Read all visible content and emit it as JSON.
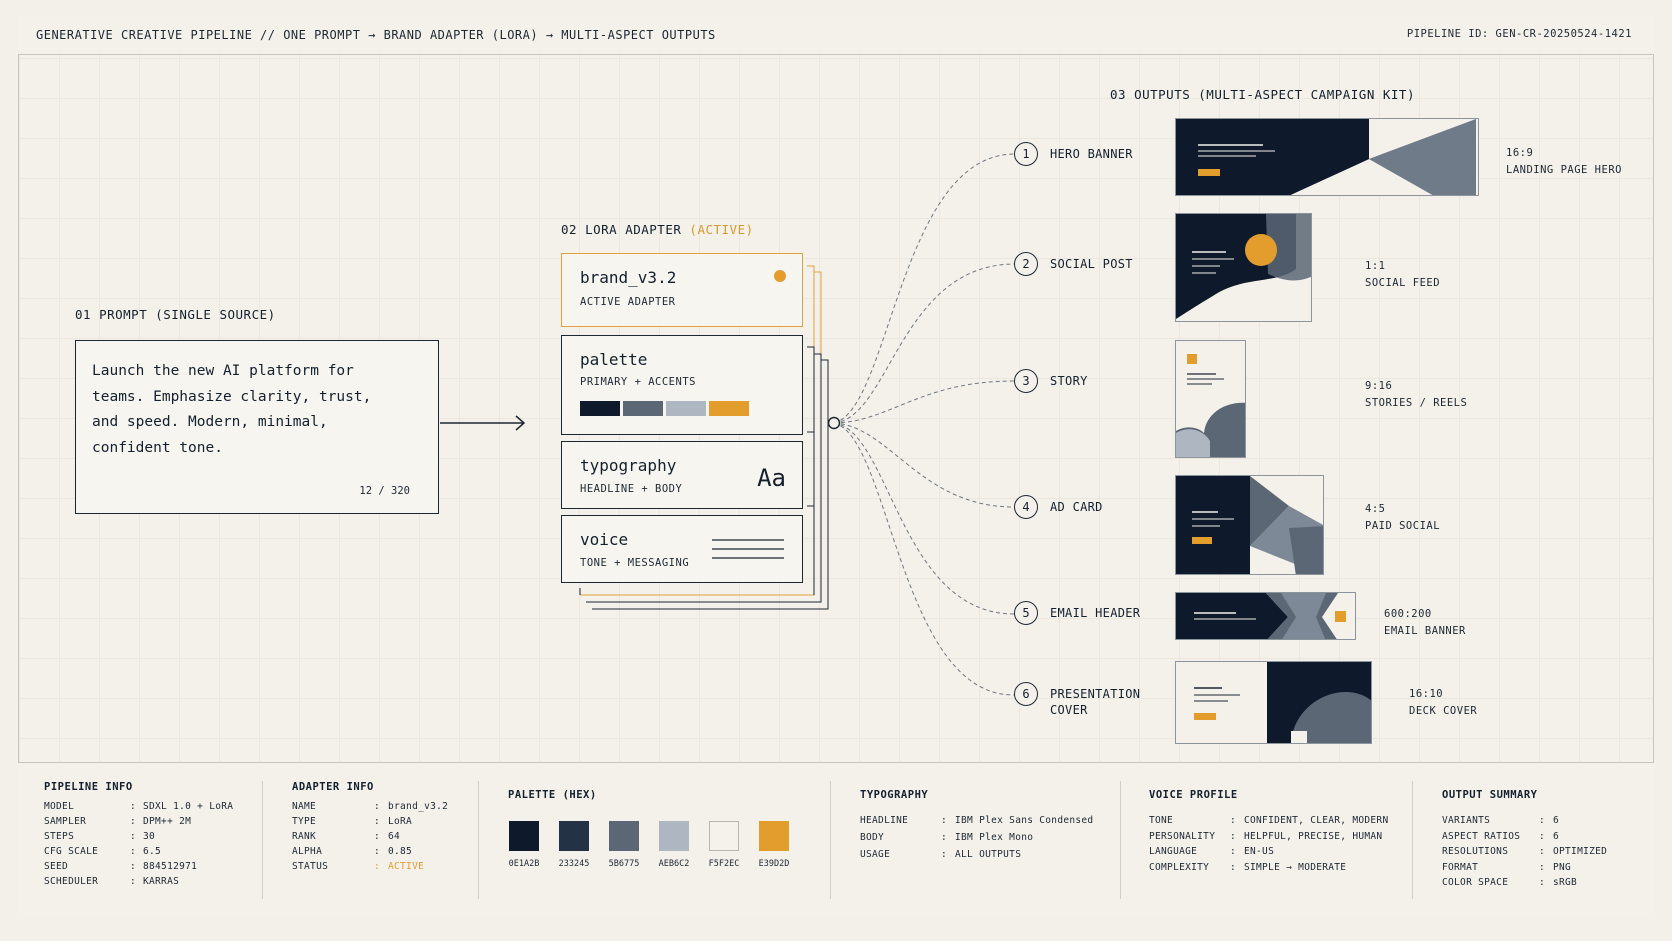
{
  "header": {
    "title": "GENERATIVE CREATIVE PIPELINE  // ONE PROMPT → BRAND ADAPTER (LORA) → MULTI-ASPECT OUTPUTS",
    "pipeline_id": "PIPELINE ID:  GEN-CR-20250524-1421"
  },
  "prompt": {
    "section_title": "01  PROMPT (SINGLE SOURCE)",
    "text": "Launch the new AI platform for teams. Emphasize clarity, trust, and speed. Modern, minimal, confident tone.",
    "count": "12 / 320"
  },
  "adapter": {
    "section_title": "02  LORA ADAPTER",
    "section_status": "(ACTIVE)",
    "cards": [
      {
        "title": "brand_v3.2",
        "sub": "ACTIVE ADAPTER"
      },
      {
        "title": "palette",
        "sub": "PRIMARY + ACCENTS"
      },
      {
        "title": "typography",
        "sub": "HEADLINE + BODY",
        "glyph": "Aa"
      },
      {
        "title": "voice",
        "sub": "TONE + MESSAGING"
      }
    ]
  },
  "outputs": {
    "section_title": "03  OUTPUTS (MULTI-ASPECT CAMPAIGN KIT)",
    "items": [
      {
        "n": "1",
        "label": "HERO BANNER",
        "ratio": "16:9",
        "use": "LANDING PAGE HERO"
      },
      {
        "n": "2",
        "label": "SOCIAL POST",
        "ratio": "1:1",
        "use": "SOCIAL FEED"
      },
      {
        "n": "3",
        "label": "STORY",
        "ratio": "9:16",
        "use": "STORIES / REELS"
      },
      {
        "n": "4",
        "label": "AD CARD",
        "ratio": "4:5",
        "use": "PAID SOCIAL"
      },
      {
        "n": "5",
        "label": "EMAIL HEADER",
        "ratio": "600:200",
        "use": "EMAIL BANNER"
      },
      {
        "n": "6",
        "label": "PRESENTATION",
        "label2": "COVER",
        "ratio": "16:10",
        "use": "DECK COVER"
      }
    ]
  },
  "colors": {
    "navy": "#0E1A2B",
    "slate": "#233245",
    "steel": "#5B6775",
    "mist": "#AEB6C2",
    "paper": "#F5F2EC",
    "accent": "#E39D2D"
  },
  "footer": {
    "pipeline": {
      "title": "PIPELINE INFO",
      "rows": [
        {
          "k": "MODEL",
          "v": "SDXL 1.0 + LoRA"
        },
        {
          "k": "SAMPLER",
          "v": "DPM++ 2M"
        },
        {
          "k": "STEPS",
          "v": "30"
        },
        {
          "k": "CFG SCALE",
          "v": "6.5"
        },
        {
          "k": "SEED",
          "v": "884512971"
        },
        {
          "k": "SCHEDULER",
          "v": "KARRAS"
        }
      ]
    },
    "adapter": {
      "title": "ADAPTER INFO",
      "rows": [
        {
          "k": "NAME",
          "v": "brand_v3.2"
        },
        {
          "k": "TYPE",
          "v": "LoRA"
        },
        {
          "k": "RANK",
          "v": "64"
        },
        {
          "k": "ALPHA",
          "v": "0.85"
        },
        {
          "k": "STATUS",
          "v": "ACTIVE"
        }
      ]
    },
    "palette": {
      "title": "PALETTE (HEX)",
      "swatches": [
        "0E1A2B",
        "233245",
        "5B6775",
        "AEB6C2",
        "F5F2EC",
        "E39D2D"
      ]
    },
    "typography": {
      "title": "TYPOGRAPHY",
      "rows": [
        {
          "k": "HEADLINE",
          "v": "IBM Plex Sans Condensed"
        },
        {
          "k": "BODY",
          "v": "IBM Plex Mono"
        },
        {
          "k": "USAGE",
          "v": "ALL OUTPUTS"
        }
      ]
    },
    "voice": {
      "title": "VOICE PROFILE",
      "rows": [
        {
          "k": "TONE",
          "v": "CONFIDENT, CLEAR, MODERN"
        },
        {
          "k": "PERSONALITY",
          "v": "HELPFUL, PRECISE, HUMAN"
        },
        {
          "k": "LANGUAGE",
          "v": "EN-US"
        },
        {
          "k": "COMPLEXITY",
          "v": "SIMPLE → MODERATE"
        }
      ]
    },
    "summary": {
      "title": "OUTPUT SUMMARY",
      "rows": [
        {
          "k": "VARIANTS",
          "v": "6"
        },
        {
          "k": "ASPECT RATIOS",
          "v": "6"
        },
        {
          "k": "RESOLUTIONS",
          "v": "OPTIMIZED"
        },
        {
          "k": "FORMAT",
          "v": "PNG"
        },
        {
          "k": "COLOR SPACE",
          "v": "sRGB"
        }
      ]
    }
  }
}
